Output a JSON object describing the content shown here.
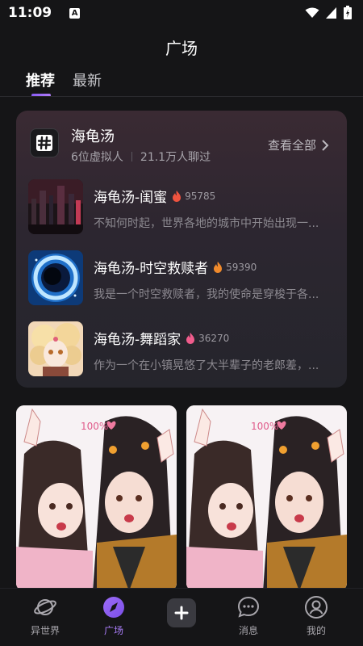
{
  "status_bar": {
    "time": "11:09",
    "indicator": "A"
  },
  "header": {
    "title": "广场",
    "tabs": [
      {
        "label": "推荐",
        "active": true
      },
      {
        "label": "最新",
        "active": false
      }
    ]
  },
  "topic_card": {
    "title": "海龟汤",
    "virtual_count": "6位虚拟人",
    "chat_count": "21.1万人聊过",
    "view_all": "查看全部",
    "items": [
      {
        "title": "海龟汤-闺蜜",
        "count": "95785",
        "desc": "不知何时起，世界各地的城市中开始出现一...",
        "fire_color": "#f0533f"
      },
      {
        "title": "海龟汤-时空救赎者",
        "count": "59390",
        "desc": "我是一个时空救赎者，我的使命是穿梭于各...",
        "fire_color": "#f08a2c"
      },
      {
        "title": "海龟汤-舞蹈家",
        "count": "36270",
        "desc": "作为一个在小镇晃悠了大半辈子的老郎差，...",
        "fire_color": "#f05c8c"
      }
    ]
  },
  "gallery": {
    "badge_text": "100%"
  },
  "bottom_nav": [
    {
      "label": "异世界",
      "icon": "planet-icon",
      "active": false
    },
    {
      "label": "广场",
      "icon": "compass-icon",
      "active": true
    },
    {
      "label": "",
      "icon": "plus-icon",
      "active": false
    },
    {
      "label": "消息",
      "icon": "message-icon",
      "active": false
    },
    {
      "label": "我的",
      "icon": "profile-icon",
      "active": false
    }
  ],
  "colors": {
    "background": "#151517",
    "accent": "#a87cf6"
  }
}
